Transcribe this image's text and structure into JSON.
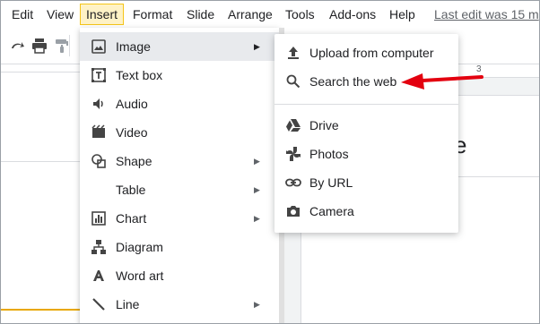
{
  "menubar": {
    "items": [
      "Edit",
      "View",
      "Insert",
      "Format",
      "Slide",
      "Arrange",
      "Tools",
      "Add-ons",
      "Help"
    ],
    "active": "Insert",
    "last_edit": "Last edit was 15 m"
  },
  "toolbar": {
    "icons": [
      "redo-icon",
      "print-icon",
      "paint-format-icon"
    ]
  },
  "ruler": {
    "tick_label": "3"
  },
  "slide": {
    "partial_text": "e"
  },
  "insert_menu": {
    "items": [
      {
        "label": "Image",
        "icon": "image-icon",
        "has_submenu": true,
        "highlighted": true
      },
      {
        "label": "Text box",
        "icon": "text-box-icon",
        "has_submenu": false
      },
      {
        "label": "Audio",
        "icon": "audio-icon",
        "has_submenu": false
      },
      {
        "label": "Video",
        "icon": "video-icon",
        "has_submenu": false
      },
      {
        "label": "Shape",
        "icon": "shape-icon",
        "has_submenu": true
      },
      {
        "label": "Table",
        "icon": "",
        "has_submenu": true
      },
      {
        "label": "Chart",
        "icon": "chart-icon",
        "has_submenu": true
      },
      {
        "label": "Diagram",
        "icon": "diagram-icon",
        "has_submenu": false
      },
      {
        "label": "Word art",
        "icon": "word-art-icon",
        "has_submenu": false
      },
      {
        "label": "Line",
        "icon": "line-icon",
        "has_submenu": true
      }
    ]
  },
  "image_submenu": {
    "items": [
      {
        "label": "Upload from computer",
        "icon": "upload-icon"
      },
      {
        "label": "Search the web",
        "icon": "search-icon"
      },
      {
        "label": "Drive",
        "icon": "drive-icon"
      },
      {
        "label": "Photos",
        "icon": "photos-icon"
      },
      {
        "label": "By URL",
        "icon": "link-icon"
      },
      {
        "label": "Camera",
        "icon": "camera-icon"
      }
    ]
  },
  "colors": {
    "active_menu_bg": "#fef2c6",
    "active_menu_border": "#f5c518",
    "annotation_arrow": "#e3000f",
    "highlight_row": "#e8eaed"
  }
}
